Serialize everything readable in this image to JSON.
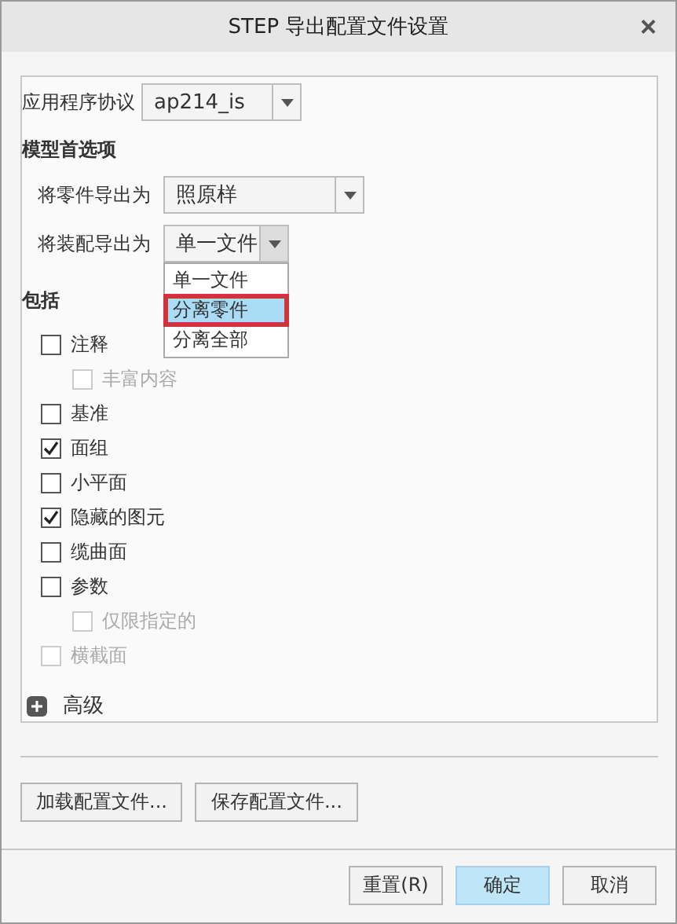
{
  "window": {
    "title": "STEP 导出配置文件设置",
    "close": "×"
  },
  "protocol": {
    "label": "应用程序协议",
    "value": "ap214_is"
  },
  "model_prefs": {
    "heading": "模型首选项",
    "part_export": {
      "label": "将零件导出为",
      "value": "照原样"
    },
    "assembly_export": {
      "label": "将装配导出为",
      "value": "单一文件",
      "expanded": true,
      "options": [
        {
          "label": "单一文件",
          "highlighted": false,
          "marked": false
        },
        {
          "label": "分离零件",
          "highlighted": true,
          "marked": true
        },
        {
          "label": "分离全部",
          "highlighted": false,
          "marked": false
        }
      ]
    }
  },
  "include": {
    "heading": "包括",
    "items": [
      {
        "label": "注释",
        "checked": false,
        "disabled": false,
        "children": [
          {
            "label": "丰富内容",
            "checked": false,
            "disabled": true
          }
        ]
      },
      {
        "label": "基准",
        "checked": false,
        "disabled": false
      },
      {
        "label": "面组",
        "checked": true,
        "disabled": false
      },
      {
        "label": "小平面",
        "checked": false,
        "disabled": false
      },
      {
        "label": "隐藏的图元",
        "checked": true,
        "disabled": false
      },
      {
        "label": "缆曲面",
        "checked": false,
        "disabled": false
      },
      {
        "label": "参数",
        "checked": false,
        "disabled": false,
        "children": [
          {
            "label": "仅限指定的",
            "checked": false,
            "disabled": true
          }
        ]
      },
      {
        "label": "横截面",
        "checked": false,
        "disabled": true
      }
    ]
  },
  "advanced": {
    "label": "高级",
    "expanded": false
  },
  "profile_buttons": [
    {
      "label": "加载配置文件..."
    },
    {
      "label": "保存配置文件..."
    }
  ],
  "footer_buttons": [
    {
      "label": "重置(R)",
      "default": false
    },
    {
      "label": "确定",
      "default": true
    },
    {
      "label": "取消",
      "default": false
    }
  ]
}
